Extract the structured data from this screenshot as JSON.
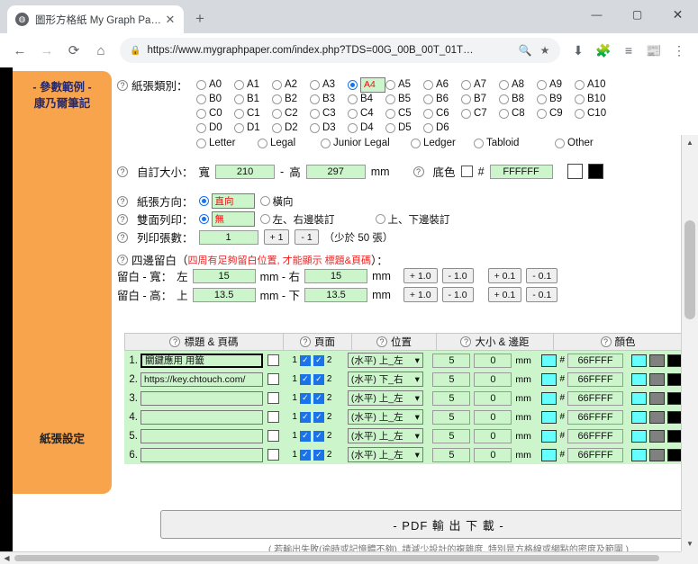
{
  "browser": {
    "tab": {
      "title": "圖形方格紙 My Graph Paper",
      "favicon": "globe-icon",
      "close": "✕"
    },
    "newtab_label": "+",
    "window": {
      "minimize": "—",
      "maximize": "▢",
      "close": "✕"
    },
    "nav": {
      "back": "←",
      "forward": "→",
      "reload": "⟳",
      "home": "⌂"
    },
    "omnibox": {
      "lock": "🔒",
      "url": "https://www.mygraphpaper.com/index.php?TDS=00G_00B_00T_01T…",
      "zoom_icon": "search-icon",
      "bookmark_icon": "★"
    },
    "toolbar_icons": [
      "download-icon",
      "extensions-icon",
      "reading-list-icon",
      "profile-icon",
      "menu-icon"
    ]
  },
  "sidebar": {
    "top_line1": "- 參數範例 -",
    "top_line2": "康乃爾筆記",
    "bottom": "紙張設定"
  },
  "paper": {
    "label": "紙張類別：",
    "rows": [
      [
        "A0",
        "A1",
        "A2",
        "A3",
        "A4",
        "A5",
        "A6",
        "A7",
        "A8",
        "A9",
        "A10"
      ],
      [
        "B0",
        "B1",
        "B2",
        "B3",
        "B4",
        "B5",
        "B6",
        "B7",
        "B8",
        "B9",
        "B10"
      ],
      [
        "C0",
        "C1",
        "C2",
        "C3",
        "C4",
        "C5",
        "C6",
        "C7",
        "C8",
        "C9",
        "C10"
      ],
      [
        "D0",
        "D1",
        "D2",
        "D3",
        "D4",
        "D5",
        "D6"
      ]
    ],
    "selected": "A4",
    "named": [
      "Letter",
      "Legal",
      "Junior Legal",
      "Ledger",
      "Tabloid"
    ],
    "other": "Other"
  },
  "custom": {
    "label": "自訂大小：",
    "width_label": "寬",
    "width_value": "210",
    "dash": "-",
    "height_label": "高",
    "height_value": "297",
    "unit": "mm",
    "bg_label": "底色",
    "hash": "#",
    "bg_value": "FFFFFF",
    "swatch_white": "#FFFFFF",
    "swatch_black": "#000000"
  },
  "orientation": {
    "label": "紙張方向：",
    "options": [
      "直向",
      "橫向"
    ],
    "selected": "直向"
  },
  "duplex": {
    "label": "雙面列印：",
    "options": [
      "無",
      "左、右邊裝訂",
      "上、下邊裝訂"
    ],
    "selected": "無"
  },
  "copies": {
    "label": "列印張數：",
    "value": "1",
    "plus": "+ 1",
    "minus": "- 1",
    "hint": "（少於 50 張）"
  },
  "margins": {
    "label": "四邊留白（",
    "label_red": "四周有足夠留白位置, 才能顯示 標題&頁碼",
    "label_end": "）：",
    "width_row": {
      "title": "留白 - 寬：",
      "left_label": "左",
      "left_value": "15",
      "mid_label": "mm - 右",
      "right_value": "15",
      "unit": "mm",
      "buttons": [
        "+ 1.0",
        "- 1.0",
        "+ 0.1",
        "- 0.1"
      ]
    },
    "height_row": {
      "title": "留白 - 高：",
      "left_label": "上",
      "left_value": "13.5",
      "mid_label": "mm - 下",
      "right_value": "13.5",
      "unit": "mm",
      "buttons": [
        "+ 1.0",
        "- 1.0",
        "+ 0.1",
        "- 0.1"
      ]
    }
  },
  "table": {
    "headers": [
      "標題 & 頁碼",
      "頁面",
      "位置",
      "大小 & 邊距",
      "顏色"
    ],
    "page_left_label": "1",
    "page_right_label": "2",
    "unit": "mm",
    "hash": "#",
    "rows": [
      {
        "num": "1.",
        "title": "關鍵應用 用籤",
        "focused": true,
        "pos": "(水平) 上_左",
        "size": "5",
        "gap": "0",
        "color": "66FFFF"
      },
      {
        "num": "2.",
        "title": "https://key.chtouch.com/",
        "focused": false,
        "pos": "(水平) 下_右",
        "size": "5",
        "gap": "0",
        "color": "66FFFF"
      },
      {
        "num": "3.",
        "title": "",
        "focused": false,
        "pos": "(水平) 上_左",
        "size": "5",
        "gap": "0",
        "color": "66FFFF"
      },
      {
        "num": "4.",
        "title": "",
        "focused": false,
        "pos": "(水平) 上_左",
        "size": "5",
        "gap": "0",
        "color": "66FFFF"
      },
      {
        "num": "5.",
        "title": "",
        "focused": false,
        "pos": "(水平) 上_左",
        "size": "5",
        "gap": "0",
        "color": "66FFFF"
      },
      {
        "num": "6.",
        "title": "",
        "focused": false,
        "pos": "(水平) 上_左",
        "size": "5",
        "gap": "0",
        "color": "66FFFF"
      }
    ]
  },
  "footer": {
    "pdf_button": "- PDF 輸 出 下 載 -",
    "note": "( 若輸出失敗(逾時或記憶體不夠), 請減少設計的複雜度, 特別是方格線或網點的密度及範圍 )"
  },
  "colors": {
    "accent_orange": "#F7A44D",
    "input_green": "#CCF5CC",
    "selected_red": "#EE2222",
    "radio_blue": "#1A73E8",
    "cyan": "#66FFFF"
  }
}
